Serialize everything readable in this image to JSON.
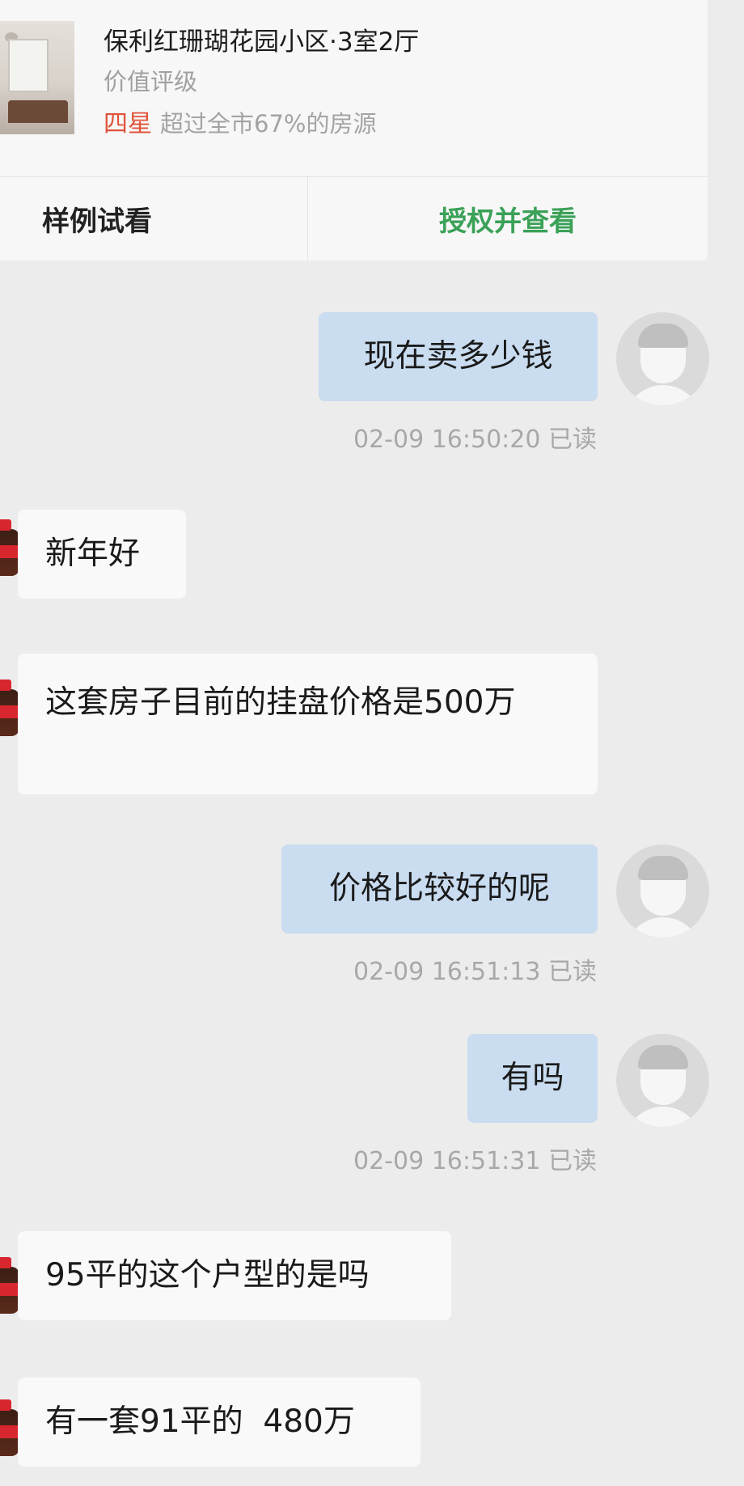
{
  "property_card": {
    "title": "保利红珊瑚花园小区·3室2厅",
    "subtitle": "价值评级",
    "rating": "四星",
    "rating_desc": "超过全市67%的房源",
    "sample_button": "样例试看",
    "authorize_button": "授权并查看",
    "colors": {
      "rating": "#e0533a",
      "authorize": "#3aa157"
    }
  },
  "messages": [
    {
      "sender": "me",
      "text": "现在卖多少钱",
      "time": "02-09 16:50:20",
      "status": "已读"
    },
    {
      "sender": "agent",
      "text": "新年好"
    },
    {
      "sender": "agent",
      "text": "这套房子目前的挂盘价格是500万"
    },
    {
      "sender": "me",
      "text": "价格比较好的呢",
      "time": "02-09 16:51:13",
      "status": "已读"
    },
    {
      "sender": "me",
      "text": "有吗",
      "time": "02-09 16:51:31",
      "status": "已读"
    },
    {
      "sender": "agent",
      "text": "95平的这个户型的是吗"
    },
    {
      "sender": "agent",
      "text": "有一套91平的  480万"
    }
  ],
  "icons": {
    "user_avatar": "default-user-avatar-icon",
    "agent_avatar": "cola-bottle-avatar-icon"
  },
  "colors": {
    "my_bubble": "#c9dcf0",
    "their_bubble": "#f9f9f9",
    "background": "#ececec"
  }
}
